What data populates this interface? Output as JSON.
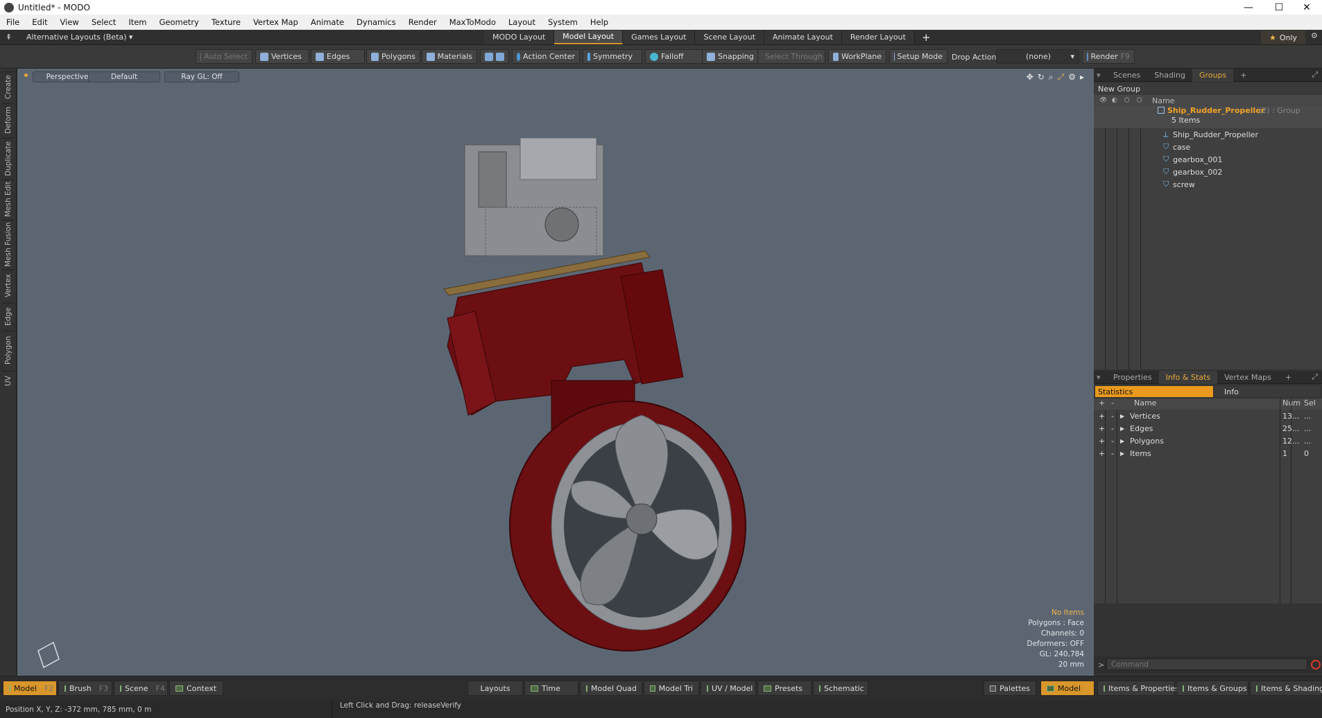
{
  "window": {
    "title": "Untitled* - MODO",
    "minimize": "—",
    "maximize": "☐",
    "close": "✕"
  },
  "menu": [
    "File",
    "Edit",
    "View",
    "Select",
    "Item",
    "Geometry",
    "Texture",
    "Vertex Map",
    "Animate",
    "Dynamics",
    "Render",
    "MaxToModo",
    "Layout",
    "System",
    "Help"
  ],
  "layoutbar": {
    "alt_layouts": "Alternative Layouts (Beta) ▾",
    "tabs": [
      "MODO Layout",
      "Model Layout",
      "Games Layout",
      "Scene Layout",
      "Animate Layout",
      "Render Layout"
    ],
    "active_tab": "Model Layout",
    "add": "+",
    "only": "Only"
  },
  "toolbar": {
    "auto_select": "Auto Select",
    "vertices": "Vertices",
    "edges": "Edges",
    "polygons": "Polygons",
    "materials": "Materials",
    "action_center": "Action Center",
    "symmetry": "Symmetry",
    "falloff": "Falloff",
    "snapping": "Snapping",
    "select_through": "Select Through",
    "workplane": "WorkPlane",
    "setup_mode": "Setup Mode",
    "drop_action": "Drop Action",
    "drop_value": "(none)",
    "render": "Render",
    "render_key": "F9"
  },
  "left_tabs": [
    "Create",
    "Deform",
    "Duplicate",
    "Mesh Edit",
    "Mesh Fusion",
    "Vertex",
    "Edge",
    "Polygon",
    "UV"
  ],
  "viewport": {
    "view": "Perspective",
    "style": "Default",
    "raygl": "Ray GL: Off",
    "stats": {
      "selection": "No Items",
      "polygons": "Polygons : Face",
      "channels": "Channels: 0",
      "deformers": "Deformers: OFF",
      "gl": "GL: 240,784",
      "scale": "20 mm"
    }
  },
  "groups_panel": {
    "tabs": [
      "Scenes",
      "Shading",
      "Groups"
    ],
    "active_tab": "Groups",
    "add": "+",
    "new_group": "New Group",
    "name_col": "Name",
    "group_name": "Ship_Rudder_Propeller",
    "group_type": "(2) : Group",
    "group_count": "5 Items",
    "items": [
      "Ship_Rudder_Propeller",
      "case",
      "gearbox_001",
      "gearbox_002",
      "screw"
    ]
  },
  "info_panel": {
    "tabs": [
      "Properties",
      "Info & Stats",
      "Vertex Maps"
    ],
    "active_tab": "Info & Stats",
    "add": "+",
    "statistics": "Statistics",
    "info": "Info",
    "cols": {
      "name": "Name",
      "num": "Num",
      "sel": "Sel"
    },
    "rows": [
      {
        "name": "Vertices",
        "num": "13...",
        "sel": "..."
      },
      {
        "name": "Edges",
        "num": "25...",
        "sel": "..."
      },
      {
        "name": "Polygons",
        "num": "12...",
        "sel": "..."
      },
      {
        "name": "Items",
        "num": "1",
        "sel": "0"
      }
    ],
    "command_placeholder": "Command"
  },
  "bottom_bar": {
    "model": "Model",
    "model_key": "F2",
    "brush": "Brush",
    "brush_key": "F3",
    "scene": "Scene",
    "scene_key": "F4",
    "context": "Context",
    "layouts": "Layouts",
    "time": "Time",
    "model_quad": "Model Quad",
    "model_tri": "Model Tri",
    "uv_model": "UV / Model",
    "presets": "Presets",
    "schematic": "Schematic",
    "palettes": "Palettes",
    "model_right": "Model",
    "items_properties": "Items & Properties",
    "items_groups": "Items & Groups",
    "items_shading": "Items & Shading"
  },
  "status": {
    "position": "Position X, Y, Z:  -372 mm, 785 mm, 0 m",
    "hint": "Left Click and Drag:  releaseVerify"
  },
  "colors": {
    "accent": "#e8a73a",
    "viewport_bg": "#5c6673",
    "hull_red": "#6b0f12"
  }
}
